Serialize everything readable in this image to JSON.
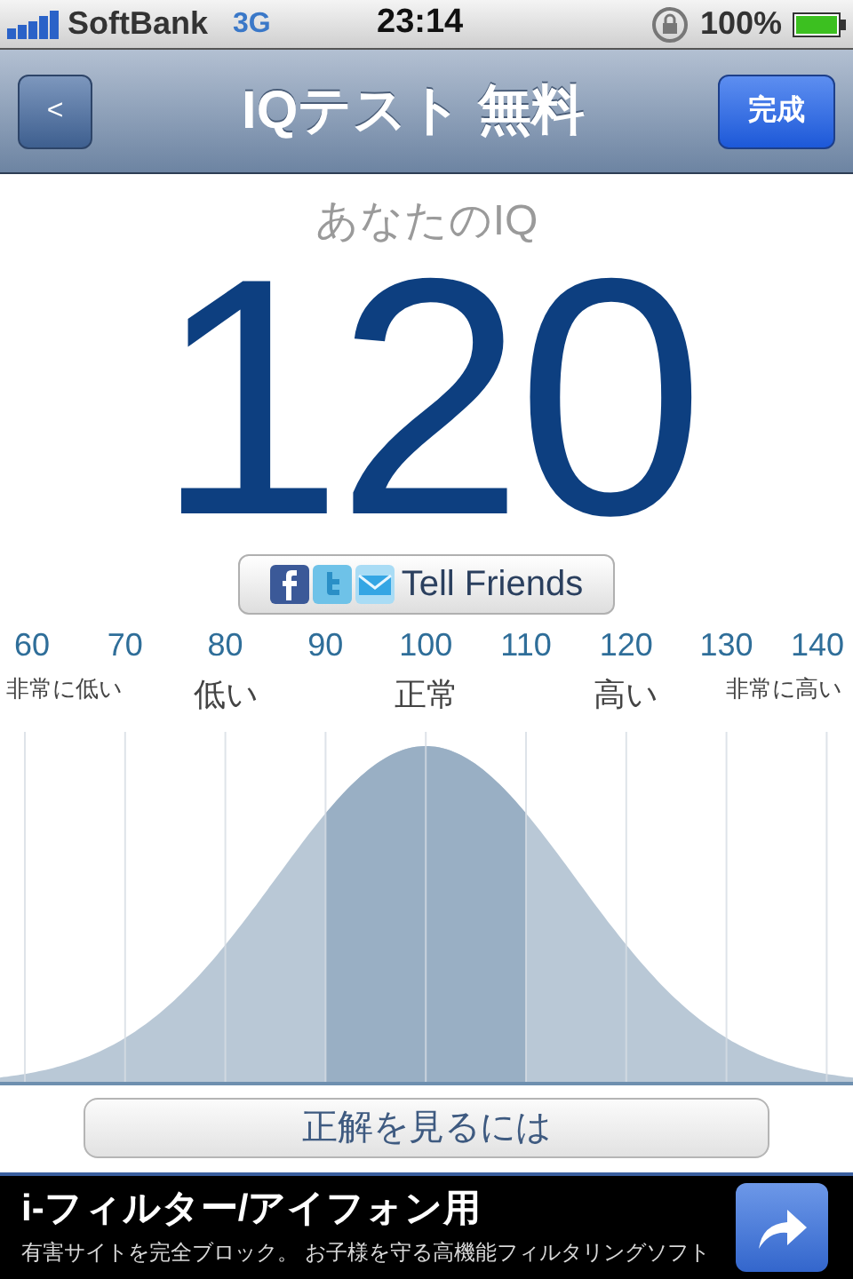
{
  "status_bar": {
    "carrier": "SoftBank",
    "network": "3G",
    "time": "23:14",
    "battery": "100%"
  },
  "nav_bar": {
    "back": "<",
    "title": "IQテスト 無料",
    "done": "完成"
  },
  "result": {
    "label": "あなたのIQ",
    "score": "120"
  },
  "share_button": "Tell Friends",
  "scale": {
    "ticks": [
      "60",
      "70",
      "80",
      "90",
      "100",
      "110",
      "120",
      "130",
      "140"
    ],
    "categories": [
      "非常に低い",
      "低い",
      "正常",
      "高い",
      "非常に高い"
    ]
  },
  "answer_button": "正解を見るには",
  "ad": {
    "title": "i-フィルター/アイフォン用",
    "text": "有害サイトを完全ブロック。 お子様を守る高機能フィルタリングソフト"
  }
}
